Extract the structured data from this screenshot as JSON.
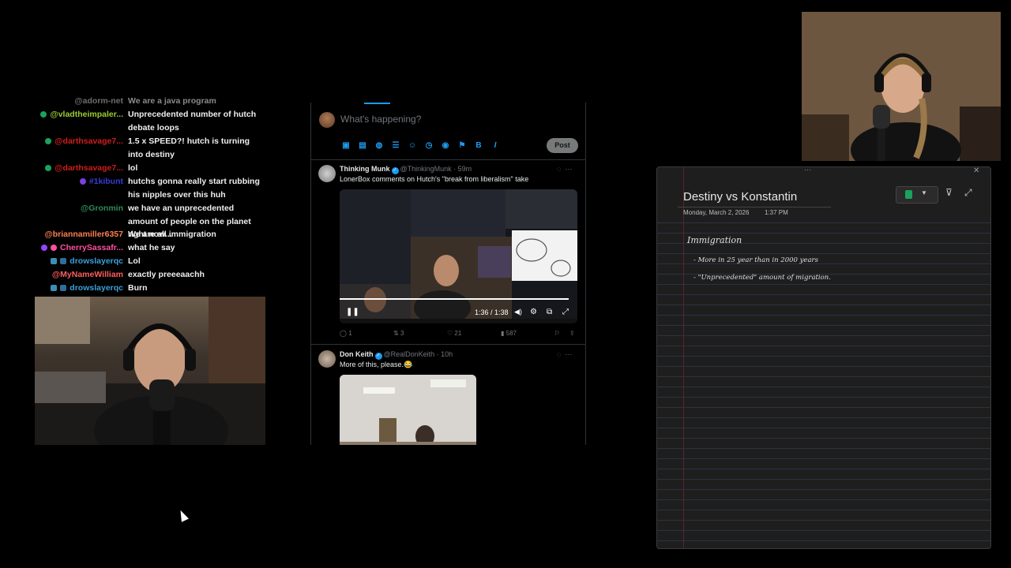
{
  "chat": {
    "messages": [
      {
        "user": "@adorm-net",
        "text": "We are a java program",
        "color": "#6d6d6d",
        "badge_color": "#1a1a1a"
      },
      {
        "user": "@vladtheimpaler...",
        "text": "Unprecedented number of hutch debate loops",
        "color": "#9acd32",
        "badge_color": "#1aa35a"
      },
      {
        "user": "@darthsavage7...",
        "text": "1.5 x SPEED?! hutch is turning into destiny",
        "color": "#d11c1c",
        "badge_color": "#1aa35a"
      },
      {
        "user": "@darthsavage7...",
        "text": "lol",
        "color": "#d11c1c",
        "badge_color": "#1aa35a"
      },
      {
        "user": "#1kibunt",
        "text": "hutchs gonna really start rubbing his nipples over this huh",
        "color": "#3a3ad6",
        "badge_color": "#7b3fe4"
      },
      {
        "user": "@Gronmin",
        "text": "we have an unprecedented amount of people on the planet right now...",
        "color": "#2e8b57",
        "badge_color": ""
      },
      {
        "user": "@briannamiller6357",
        "text": "We are all immigration",
        "color": "#ff7f50",
        "badge_color": ""
      },
      {
        "user": "CherrySassafr...",
        "text": "what he say",
        "color": "#ff4fa0",
        "badge_color": "#9147ff"
      },
      {
        "user": "drowslayerqc",
        "text": "Lol",
        "color": "#3aa0d8",
        "badge_color": "#3a8fb7"
      },
      {
        "user": "@MyNameWilliam",
        "text": "exactly preeeaachh",
        "color": "#ff5f5f",
        "badge_color": ""
      },
      {
        "user": "drowslayerqc",
        "text": "Burn",
        "color": "#3aa0d8",
        "badge_color": "#3a8fb7"
      }
    ]
  },
  "x": {
    "compose_placeholder": "What's happening?",
    "post_label": "Post",
    "tools": [
      "image-icon",
      "gif-icon",
      "grok-icon",
      "list-icon",
      "emoji-icon",
      "schedule-icon",
      "location-icon",
      "flag-icon",
      "bold-icon",
      "italic-icon"
    ],
    "tweets": [
      {
        "name": "Thinking Munk",
        "handle": "@ThinkingMunk · 59m",
        "text": "LonerBox comments on Hutch's \"break from liberalism\" take",
        "video_time": "1:36 / 1:38",
        "replies": "1",
        "reposts": "3",
        "likes": "21",
        "views": "587"
      },
      {
        "name": "Don Keith",
        "handle": "@RealDonKeith · 10h",
        "text": "More of this, please.😂"
      }
    ]
  },
  "notes": {
    "title": "Destiny vs Konstantin",
    "date": "Monday, March 2, 2026",
    "time": "1:37 PM",
    "handwriting": [
      "Immigration",
      "- More in 25 year than in 2000 years",
      "- \"Unprecedented\" amount of migration."
    ],
    "accent": "#1aa35a"
  }
}
